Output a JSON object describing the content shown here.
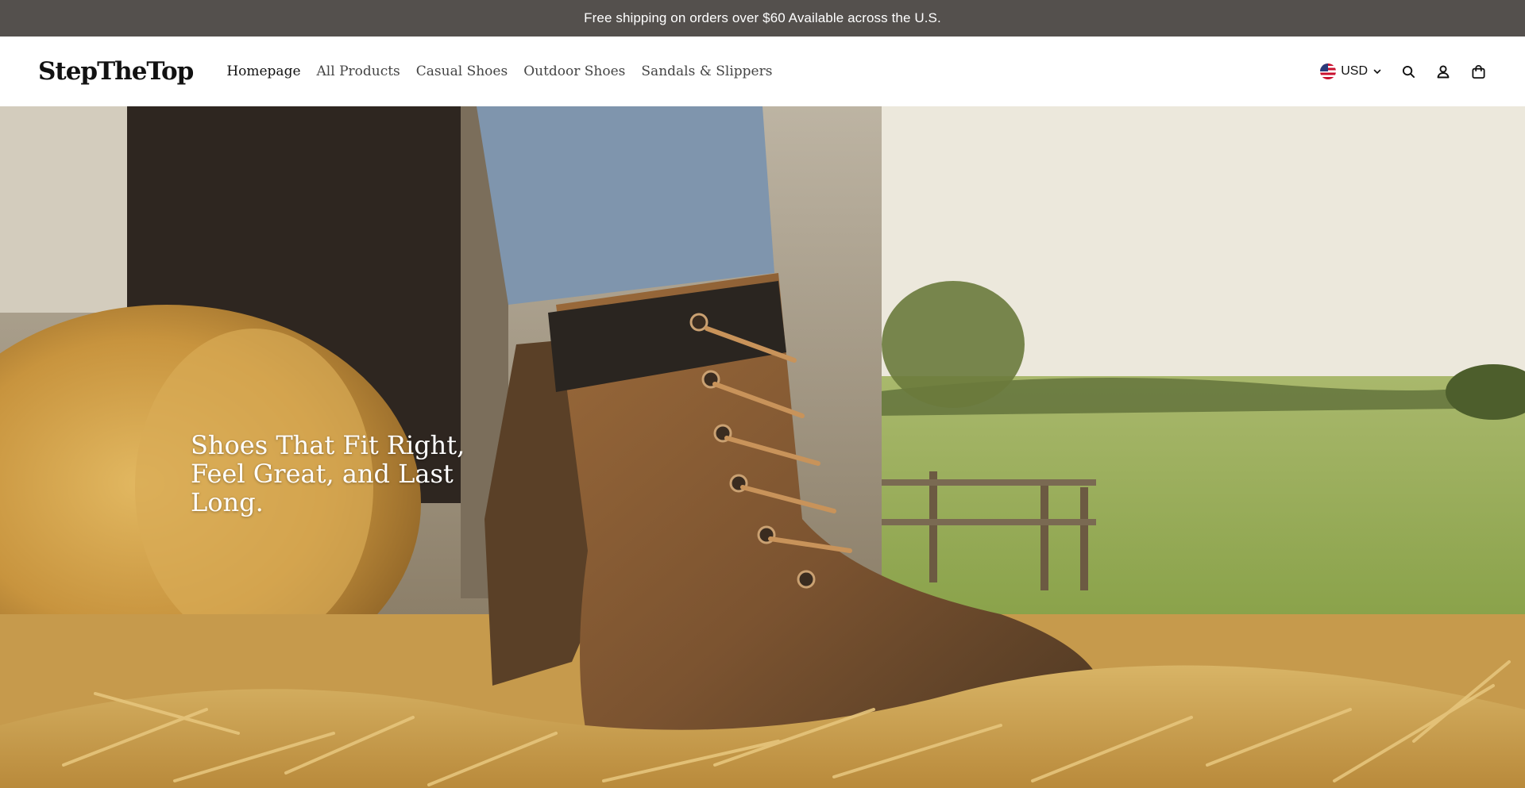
{
  "announcement": {
    "text": "Free shipping on orders over $60 Available across the U.S."
  },
  "header": {
    "logo": "StepTheTop",
    "nav": [
      {
        "label": "Homepage",
        "active": true
      },
      {
        "label": "All Products",
        "active": false
      },
      {
        "label": "Casual Shoes",
        "active": false
      },
      {
        "label": "Outdoor Shoes",
        "active": false
      },
      {
        "label": "Sandals & Slippers",
        "active": false
      }
    ],
    "currency": {
      "code": "USD",
      "flag": "us-flag-icon"
    },
    "icons": [
      "search-icon",
      "account-icon",
      "cart-bag-icon"
    ]
  },
  "hero": {
    "headline": "Shoes That Fit Right, Feel Great, and Last Long.",
    "image": "brown leather lace-up work boot standing on straw near a barn and hay bale"
  },
  "colors": {
    "announcement_bg": "#54504d",
    "header_bg": "#ffffff",
    "text_dark": "#111111",
    "nav_text": "#444444"
  }
}
